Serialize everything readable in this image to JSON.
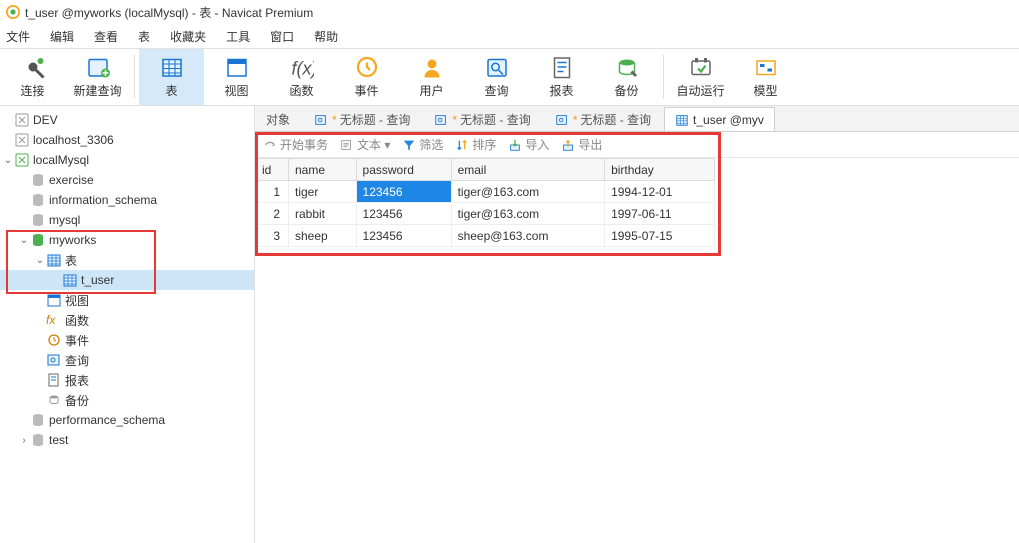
{
  "window_title": "t_user @myworks (localMysql) - 表 - Navicat Premium",
  "menu": [
    "文件",
    "编辑",
    "查看",
    "表",
    "收藏夹",
    "工具",
    "窗口",
    "帮助"
  ],
  "toolbar": [
    {
      "label": "连接",
      "icon": "plug"
    },
    {
      "label": "新建查询",
      "icon": "query-new"
    },
    {
      "label": "表",
      "icon": "table",
      "active": true
    },
    {
      "label": "视图",
      "icon": "view"
    },
    {
      "label": "函数",
      "icon": "fx"
    },
    {
      "label": "事件",
      "icon": "clock"
    },
    {
      "label": "用户",
      "icon": "user"
    },
    {
      "label": "查询",
      "icon": "query"
    },
    {
      "label": "报表",
      "icon": "report"
    },
    {
      "label": "备份",
      "icon": "backup"
    },
    {
      "label": "自动运行",
      "icon": "auto"
    },
    {
      "label": "模型",
      "icon": "model"
    }
  ],
  "tree": [
    {
      "label": "DEV",
      "indent": 0,
      "icon": "conn-gray",
      "toggle": ""
    },
    {
      "label": "localhost_3306",
      "indent": 0,
      "icon": "conn-gray",
      "toggle": ""
    },
    {
      "label": "localMysql",
      "indent": 0,
      "icon": "conn-green",
      "toggle": "v"
    },
    {
      "label": "exercise",
      "indent": 1,
      "icon": "db",
      "toggle": ""
    },
    {
      "label": "information_schema",
      "indent": 1,
      "icon": "db",
      "toggle": ""
    },
    {
      "label": "mysql",
      "indent": 1,
      "icon": "db",
      "toggle": ""
    },
    {
      "label": "myworks",
      "indent": 1,
      "icon": "db-open",
      "toggle": "v"
    },
    {
      "label": "表",
      "indent": 2,
      "icon": "table",
      "toggle": "v"
    },
    {
      "label": "t_user",
      "indent": 3,
      "icon": "table",
      "toggle": "",
      "selected": true
    },
    {
      "label": "视图",
      "indent": 2,
      "icon": "view",
      "toggle": ""
    },
    {
      "label": "函数",
      "indent": 2,
      "icon": "fx-small",
      "toggle": ""
    },
    {
      "label": "事件",
      "indent": 2,
      "icon": "clock-small",
      "toggle": ""
    },
    {
      "label": "查询",
      "indent": 2,
      "icon": "query-small",
      "toggle": ""
    },
    {
      "label": "报表",
      "indent": 2,
      "icon": "report-small",
      "toggle": ""
    },
    {
      "label": "备份",
      "indent": 2,
      "icon": "backup-small",
      "toggle": ""
    },
    {
      "label": "performance_schema",
      "indent": 1,
      "icon": "db",
      "toggle": ""
    },
    {
      "label": "test",
      "indent": 1,
      "icon": "db",
      "toggle": ">"
    }
  ],
  "tabs": [
    {
      "label": "对象",
      "icon": "",
      "star": false
    },
    {
      "label": "无标题 - 查询",
      "icon": "query-small",
      "star": true
    },
    {
      "label": "无标题 - 查询",
      "icon": "query-small",
      "star": true
    },
    {
      "label": "无标题 - 查询",
      "icon": "query-small",
      "star": true
    },
    {
      "label": "t_user @myv",
      "icon": "table",
      "star": false,
      "active": true
    }
  ],
  "gridtoolbar": [
    {
      "label": "开始事务",
      "icon": "tx"
    },
    {
      "label": "文本 ▾",
      "icon": "text"
    },
    {
      "label": "筛选",
      "icon": "filter"
    },
    {
      "label": "排序",
      "icon": "sort"
    },
    {
      "label": "导入",
      "icon": "import"
    },
    {
      "label": "导出",
      "icon": "export"
    }
  ],
  "columns": [
    "id",
    "name",
    "password",
    "email",
    "birthday"
  ],
  "rows": [
    {
      "id": "1",
      "name": "tiger",
      "password": "123456",
      "email": "tiger@163.com",
      "birthday": "1994-12-01",
      "sel": "password"
    },
    {
      "id": "2",
      "name": "rabbit",
      "password": "123456",
      "email": "tiger@163.com",
      "birthday": "1997-06-11"
    },
    {
      "id": "3",
      "name": "sheep",
      "password": "123456",
      "email": "sheep@163.com",
      "birthday": "1995-07-15"
    }
  ]
}
